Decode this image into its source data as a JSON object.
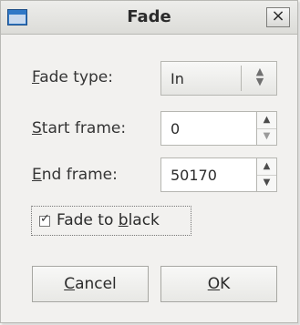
{
  "window": {
    "title": "Fade"
  },
  "form": {
    "fade_type_label": "Fade type:",
    "fade_type_value": "In",
    "start_frame_label": "Start frame:",
    "start_frame_value": "0",
    "end_frame_label": "End frame:",
    "end_frame_value": "50170",
    "fade_to_black_label": "Fade to black",
    "fade_to_black_checked": true
  },
  "buttons": {
    "cancel": "Cancel",
    "ok": "OK"
  },
  "icons": {
    "window": "window-icon",
    "close": "close-icon",
    "select_arrows": "updown-arrows-icon",
    "spin_up": "spin-up-icon",
    "spin_down": "spin-down-icon",
    "checkbox": "checkbox-checked-icon"
  }
}
